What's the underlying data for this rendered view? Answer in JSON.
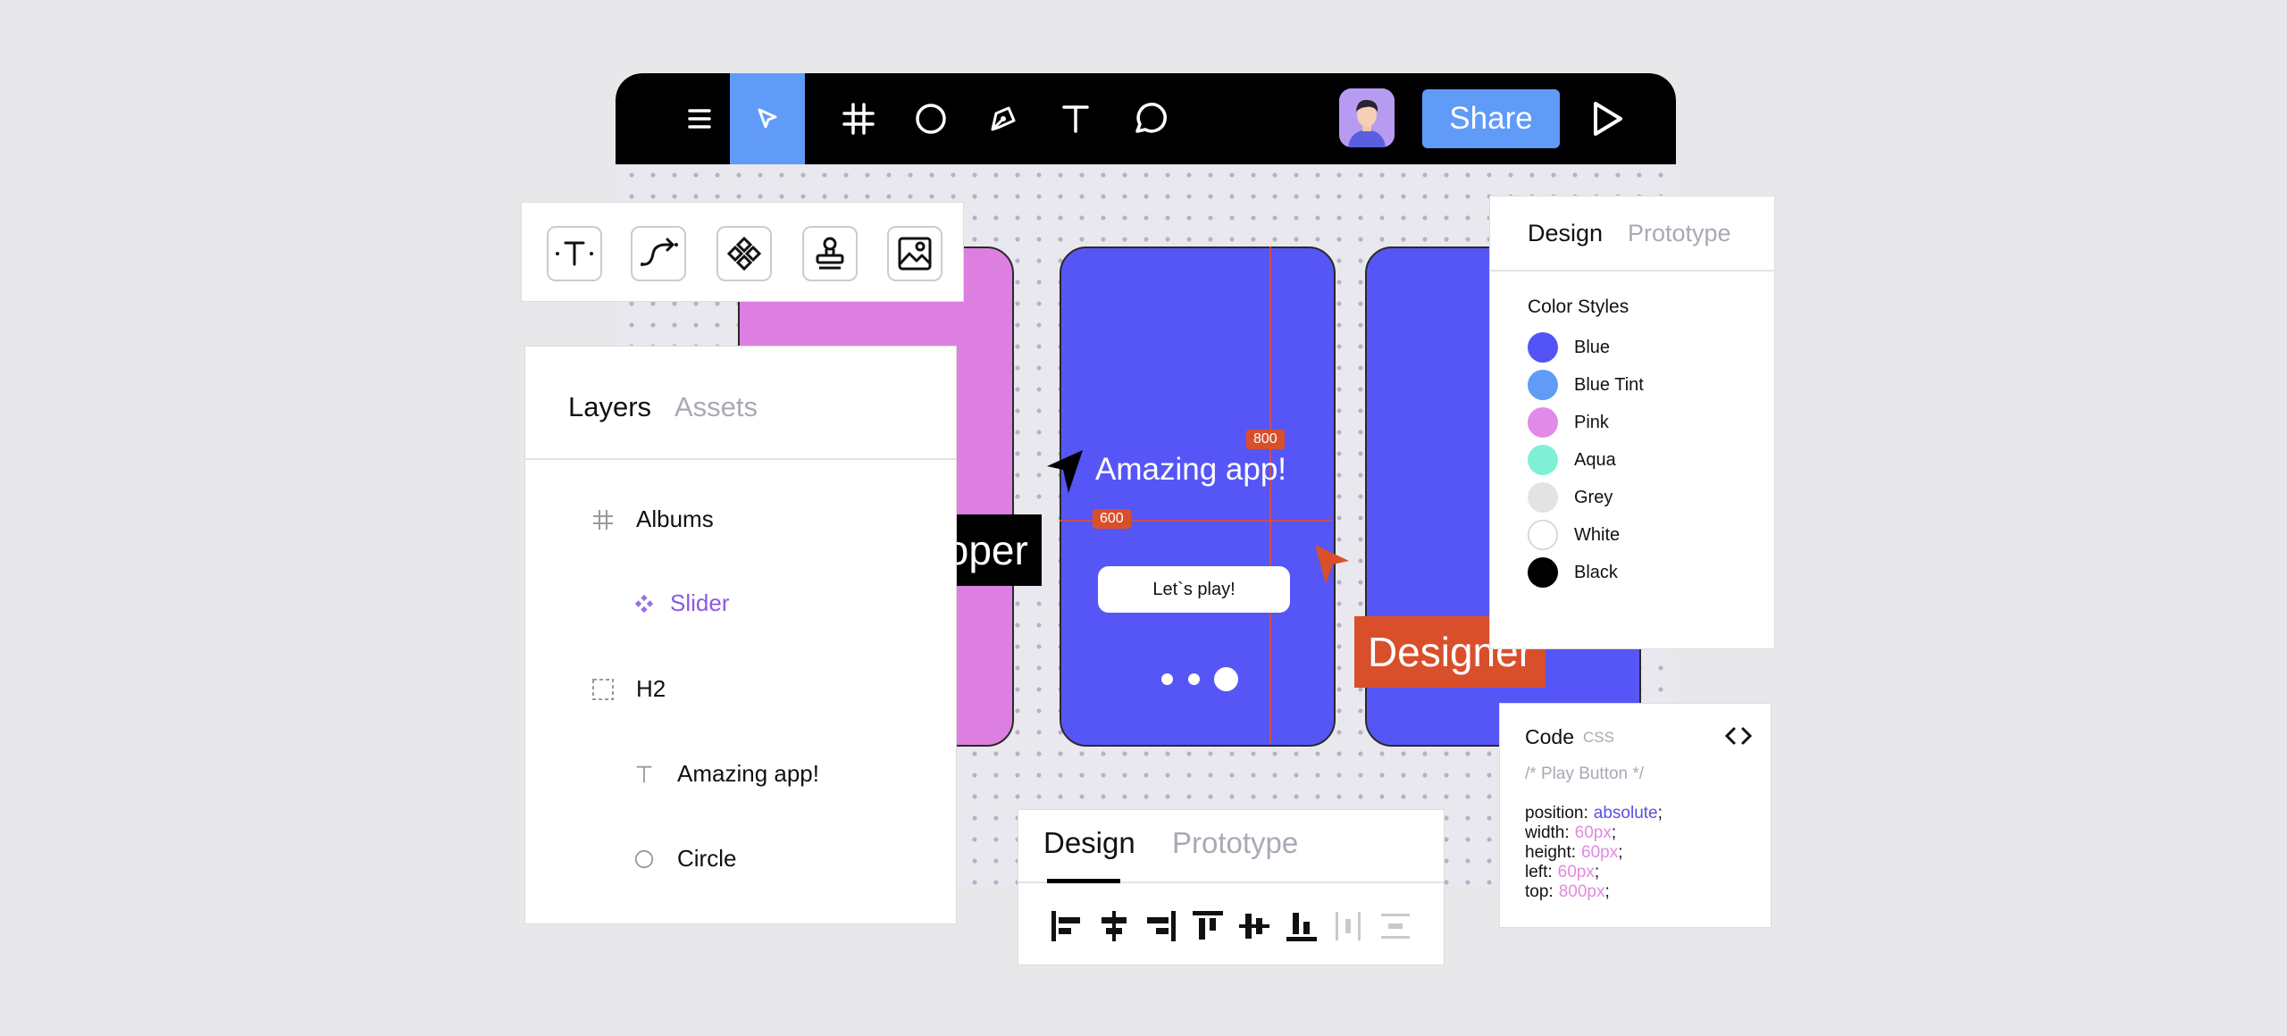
{
  "toolbar": {
    "menu_icon": "hamburger-icon",
    "tools": [
      "cursor-icon",
      "frame-icon",
      "circle-icon",
      "pen-icon",
      "text-icon",
      "comment-icon"
    ],
    "share_label": "Share",
    "play_icon": "play-icon",
    "accent": "#5f9bf7"
  },
  "insert_tools": [
    "text-tool-icon",
    "path-tool-icon",
    "component-icon",
    "stamp-icon",
    "image-icon"
  ],
  "layers_panel": {
    "tab_active": "Layers",
    "tab_inactive": "Assets",
    "items": [
      {
        "icon": "frame-icon",
        "label": "Albums"
      },
      {
        "icon": "component-icon",
        "label": "Slider"
      },
      {
        "icon": "dashed-frame-icon",
        "label": "H2"
      },
      {
        "icon": "text-icon",
        "label": "Amazing app!"
      },
      {
        "icon": "circle-icon",
        "label": "Circle"
      }
    ]
  },
  "canvas": {
    "app_title": "Amazing app!",
    "cta_label": "Let`s play!",
    "measure_v": "800",
    "measure_h": "600",
    "developer_label": "Developer",
    "designer_label": "Designer"
  },
  "design_panel": {
    "tab_active": "Design",
    "tab_inactive": "Prototype",
    "section_title": "Color Styles",
    "colors": [
      {
        "name": "Blue",
        "hex": "#5454f6"
      },
      {
        "name": "Blue Tint",
        "hex": "#5f9bf7"
      },
      {
        "name": "Pink",
        "hex": "#e28ae8"
      },
      {
        "name": "Aqua",
        "hex": "#7ff0d6"
      },
      {
        "name": "Grey",
        "hex": "#e3e3e3"
      },
      {
        "name": "White",
        "hex": "#ffffff"
      },
      {
        "name": "Black",
        "hex": "#000000"
      }
    ]
  },
  "code_panel": {
    "title": "Code",
    "lang": "CSS",
    "comment": "/* Play Button */",
    "lines": [
      {
        "prop": "position:",
        "val": "absolute",
        "color": "#5a4fe0"
      },
      {
        "prop": "width:",
        "val": "60px",
        "color": "#e08ae0"
      },
      {
        "prop": "height:",
        "val": "60px",
        "color": "#e08ae0"
      },
      {
        "prop": "left:",
        "val": "60px",
        "color": "#e08ae0"
      },
      {
        "prop": "top:",
        "val": "800px",
        "color": "#e08ae0"
      }
    ]
  },
  "bottom_panel": {
    "tab_active": "Design",
    "tab_inactive": "Prototype",
    "align_icons": [
      "align-left-icon",
      "align-center-h-icon",
      "align-right-icon",
      "align-top-icon",
      "align-middle-v-icon",
      "align-bottom-icon",
      "distribute-h-icon",
      "distribute-v-icon"
    ]
  }
}
